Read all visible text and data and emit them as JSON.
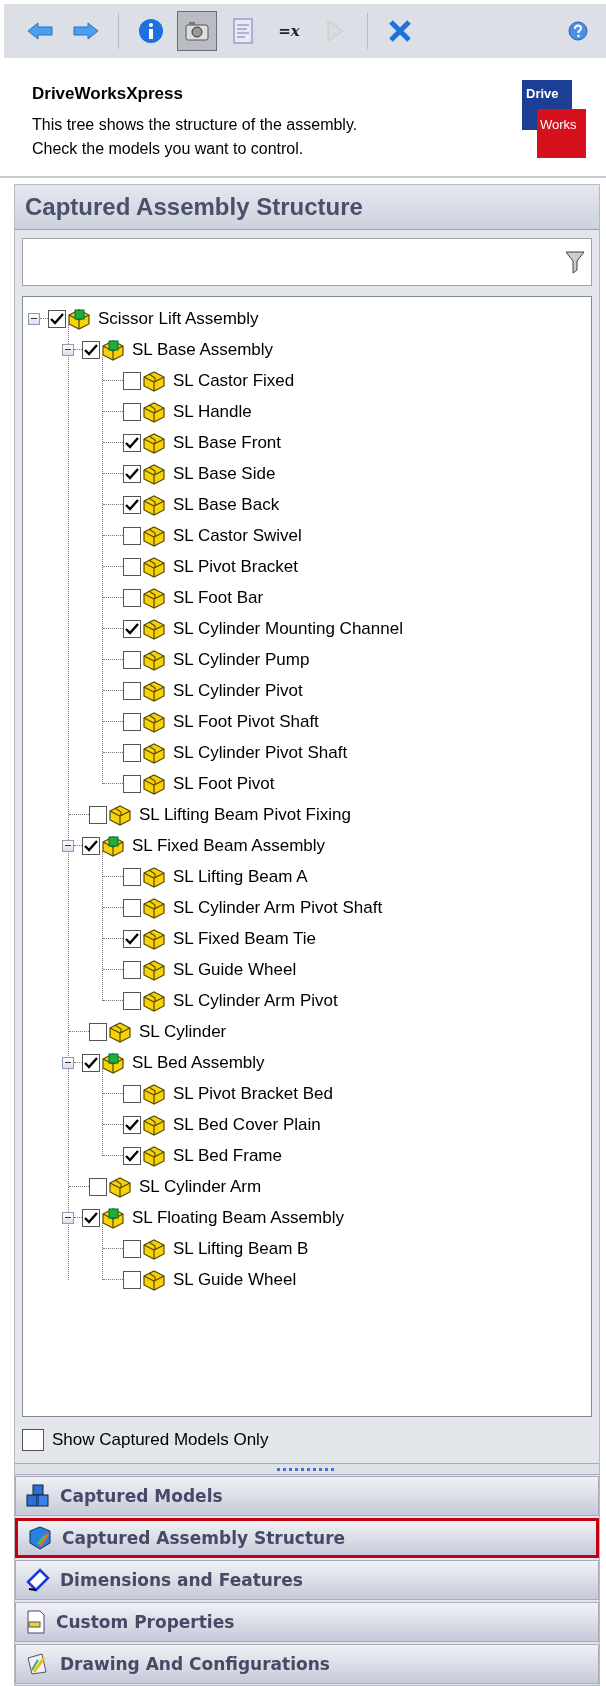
{
  "toolbar": [
    {
      "kind": "back",
      "selected": false,
      "disabled": false
    },
    {
      "kind": "forward",
      "selected": false,
      "disabled": false
    },
    {
      "kind": "separator"
    },
    {
      "kind": "info",
      "selected": false,
      "disabled": false
    },
    {
      "kind": "camera",
      "selected": true,
      "disabled": false
    },
    {
      "kind": "document",
      "selected": false,
      "disabled": false
    },
    {
      "kind": "formula",
      "label": "=x",
      "selected": false,
      "disabled": false
    },
    {
      "kind": "play",
      "selected": false,
      "disabled": true
    },
    {
      "kind": "separator"
    },
    {
      "kind": "close",
      "selected": false,
      "disabled": false
    },
    {
      "kind": "help",
      "selected": false,
      "disabled": false
    }
  ],
  "header": {
    "title": "DriveWorksXpress",
    "lines": [
      "This tree shows the structure of the assembly.",
      "Check the models you want to control."
    ],
    "logo": [
      "Drive",
      "Works"
    ]
  },
  "panel": {
    "title": "Captured Assembly Structure",
    "tree": [
      {
        "name": "Scissor Lift Assembly",
        "kind": "assembly",
        "checked": true,
        "expanded": true,
        "children": [
          {
            "name": "SL Base Assembly",
            "kind": "assembly",
            "checked": true,
            "expanded": true,
            "children": [
              {
                "name": "SL Castor Fixed",
                "kind": "part",
                "checked": false
              },
              {
                "name": "SL Handle",
                "kind": "part",
                "checked": false
              },
              {
                "name": "SL Base Front",
                "kind": "part",
                "checked": true
              },
              {
                "name": "SL Base Side",
                "kind": "part",
                "checked": true
              },
              {
                "name": "SL Base Back",
                "kind": "part",
                "checked": true
              },
              {
                "name": "SL Castor Swivel",
                "kind": "part",
                "checked": false
              },
              {
                "name": "SL Pivot Bracket",
                "kind": "part",
                "checked": false
              },
              {
                "name": "SL Foot Bar",
                "kind": "part",
                "checked": false
              },
              {
                "name": "SL Cylinder Mounting Channel",
                "kind": "part",
                "checked": true
              },
              {
                "name": "SL Cylinder Pump",
                "kind": "part",
                "checked": false
              },
              {
                "name": "SL Cylinder Pivot",
                "kind": "part",
                "checked": false
              },
              {
                "name": "SL Foot Pivot Shaft",
                "kind": "part",
                "checked": false
              },
              {
                "name": "SL Cylinder Pivot Shaft",
                "kind": "part",
                "checked": false
              },
              {
                "name": "SL Foot Pivot",
                "kind": "part",
                "checked": false
              }
            ]
          },
          {
            "name": "SL Lifting Beam Pivot Fixing",
            "kind": "part",
            "checked": false
          },
          {
            "name": "SL Fixed Beam Assembly",
            "kind": "assembly",
            "checked": true,
            "expanded": true,
            "children": [
              {
                "name": "SL Lifting Beam A",
                "kind": "part",
                "checked": false
              },
              {
                "name": "SL Cylinder Arm Pivot Shaft",
                "kind": "part",
                "checked": false
              },
              {
                "name": "SL Fixed Beam Tie",
                "kind": "part",
                "checked": true
              },
              {
                "name": "SL Guide Wheel",
                "kind": "part",
                "checked": false
              },
              {
                "name": "SL Cylinder Arm Pivot",
                "kind": "part",
                "checked": false
              }
            ]
          },
          {
            "name": "SL Cylinder",
            "kind": "part",
            "checked": false
          },
          {
            "name": "SL Bed Assembly",
            "kind": "assembly",
            "checked": true,
            "expanded": true,
            "children": [
              {
                "name": "SL Pivot Bracket Bed",
                "kind": "part",
                "checked": false
              },
              {
                "name": "SL Bed Cover Plain",
                "kind": "part",
                "checked": true
              },
              {
                "name": "SL Bed Frame",
                "kind": "part",
                "checked": true
              }
            ]
          },
          {
            "name": "SL Cylinder Arm",
            "kind": "part",
            "checked": false
          },
          {
            "name": "SL Floating Beam Assembly",
            "kind": "assembly",
            "checked": true,
            "expanded": true,
            "children": [
              {
                "name": "SL Lifting Beam B",
                "kind": "part",
                "checked": false
              },
              {
                "name": "SL Guide Wheel",
                "kind": "part",
                "checked": false
              }
            ]
          }
        ]
      }
    ],
    "show_captured_only": {
      "label": "Show Captured Models Only",
      "checked": false
    }
  },
  "nav": [
    {
      "kind": "models",
      "label": "Captured Models",
      "selected": false
    },
    {
      "kind": "structure",
      "label": "Captured Assembly Structure",
      "selected": true
    },
    {
      "kind": "dimensions",
      "label": "Dimensions and Features",
      "selected": false
    },
    {
      "kind": "properties",
      "label": "Custom Properties",
      "selected": false
    },
    {
      "kind": "drawings",
      "label": "Drawing And Configurations",
      "selected": false
    }
  ]
}
